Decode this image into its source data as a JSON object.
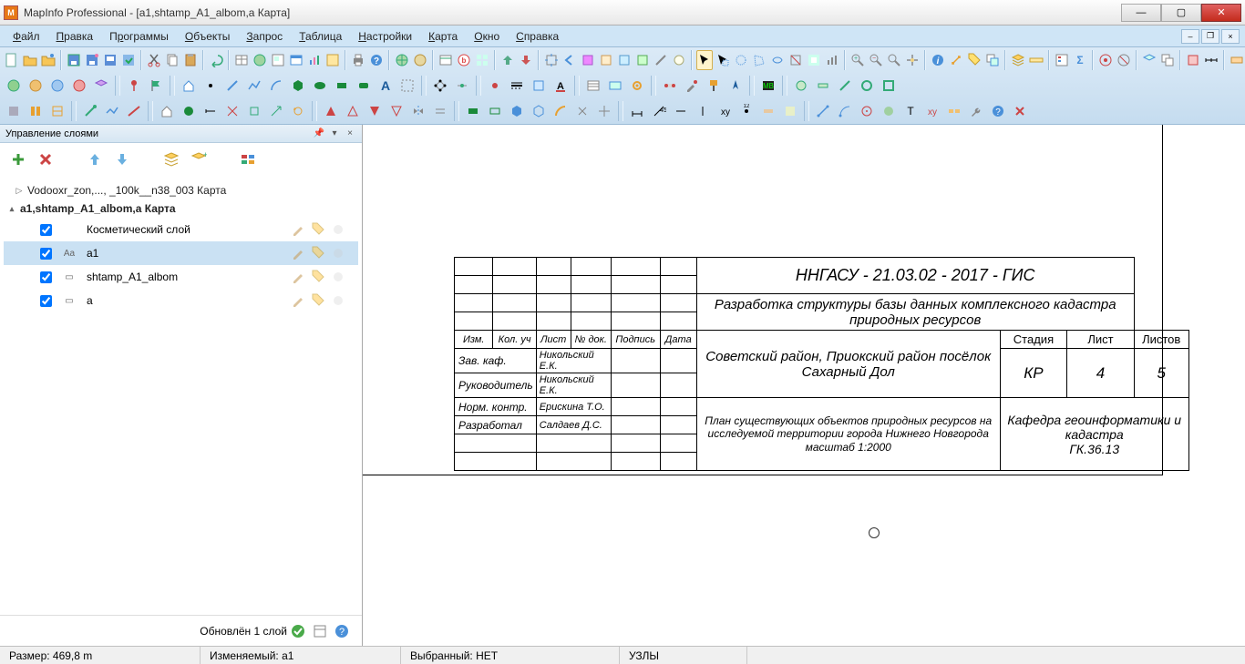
{
  "window_title": "MapInfo Professional - [a1,shtamp_A1_albom,a Карта]",
  "menu": [
    "Файл",
    "Правка",
    "Программы",
    "Объекты",
    "Запрос",
    "Таблица",
    "Настройки",
    "Карта",
    "Окно",
    "Справка"
  ],
  "panel": {
    "title": "Управление слоями",
    "footer": "Обновлён 1 слой",
    "tree_top": "Vodooxr_zon,..., _100k__n38_003 Карта",
    "group": "a1,shtamp_A1_albom,a Карта",
    "layers": [
      {
        "name": "Косметический слой",
        "sym": "",
        "checked": true,
        "sel": false
      },
      {
        "name": "a1",
        "sym": "Aa",
        "checked": true,
        "sel": true
      },
      {
        "name": "shtamp_A1_albom",
        "sym": "▭",
        "checked": true,
        "sel": false
      },
      {
        "name": "a",
        "sym": "▭",
        "checked": true,
        "sel": false
      }
    ]
  },
  "stamp": {
    "code": "ННГАСУ - 21.03.02 - 2017 - ГИС",
    "project": "Разработка структуры базы данных комплексного кадастра природных ресурсов",
    "area": "Советский район, Приокский район посёлок Сахарный Дол",
    "plan": "План существующих объектов природных ресурсов на исследуемой территории города Нижнего Новгорода масштаб 1:2000",
    "dept": "Кафедра геоинформатики и кадастра",
    "dept_code": "ГК.36.13",
    "cols": {
      "izm": "Изм.",
      "kol": "Кол. уч",
      "list": "Лист",
      "ndok": "№ док.",
      "podpis": "Подпись",
      "data": "Дата",
      "stadia": "Стадия",
      "list2": "Лист",
      "listov": "Листов"
    },
    "stadia_val": "КР",
    "list_val": "4",
    "listov_val": "5",
    "roles": [
      {
        "role": "Зав. каф.",
        "name": "Никольский Е.К."
      },
      {
        "role": "Руководитель",
        "name": "Никольский Е.К."
      },
      {
        "role": "Норм. контр.",
        "name": "Ерискина Т.О."
      },
      {
        "role": "Разработал",
        "name": "Салдаев Д.С."
      }
    ]
  },
  "status": {
    "size": "Размер: 469,8 m",
    "edit": "Изменяемый: a1",
    "sel": "Выбранный: НЕТ",
    "nodes": "УЗЛЫ"
  }
}
